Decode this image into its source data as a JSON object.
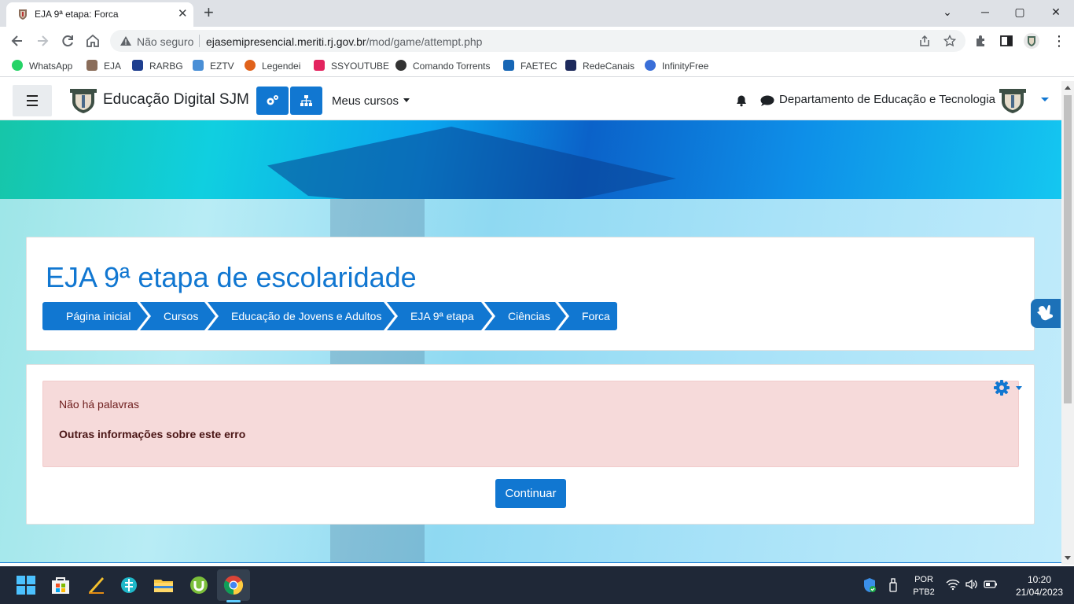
{
  "browser": {
    "tab_title": "EJA 9ª etapa: Forca",
    "tab_close_glyph": "✕",
    "new_tab_glyph": "+",
    "security_label": "Não seguro",
    "url_domain": "ejasemipresencial.meriti.rj.gov.br",
    "url_path": "/mod/game/attempt.php",
    "window_controls": {
      "minimize": "─",
      "maximize": "▢",
      "close": "✕",
      "tabsearch": "⌄"
    },
    "bookmarks": [
      {
        "label": "WhatsApp",
        "icon": "whatsapp-icon",
        "color": "#25d366"
      },
      {
        "label": "EJA",
        "icon": "eja-crest-icon",
        "color": "#8a6d5a"
      },
      {
        "label": "RARBG",
        "icon": "rarbg-icon",
        "color": "#1f3f8f"
      },
      {
        "label": "EZTV",
        "icon": "eztv-icon",
        "color": "#4a8fd6"
      },
      {
        "label": "Legendei",
        "icon": "legendei-icon",
        "color": "#e0621b"
      },
      {
        "label": "SSYOUTUBE",
        "icon": "ssyoutube-icon",
        "color": "#e3245f"
      },
      {
        "label": "Comando Torrents",
        "icon": "comando-torrents-icon",
        "color": "#333333"
      },
      {
        "label": "FAETEC",
        "icon": "faetec-icon",
        "color": "#1766b5"
      },
      {
        "label": "RedeCanais",
        "icon": "redecanais-icon",
        "color": "#1d2a5c"
      },
      {
        "label": "InfinityFree",
        "icon": "infinityfree-icon",
        "color": "#3a6fd8"
      }
    ]
  },
  "site": {
    "name": "Educação Digital SJM",
    "my_courses": "Meus cursos",
    "user_name": "Departamento de Educação e Tecnologia"
  },
  "course": {
    "title": "EJA 9ª etapa de escolaridade",
    "breadcrumb": [
      "Página inicial",
      "Cursos",
      "Educação de Jovens e Adultos",
      "EJA 9ª etapa",
      "Ciências",
      "Forca"
    ]
  },
  "error": {
    "message": "Não há palavras",
    "more_info": "Outras informações sobre este erro"
  },
  "actions": {
    "continue": "Continuar"
  },
  "taskbar": {
    "language": "POR",
    "layout": "PTB2",
    "time": "10:20",
    "date": "21/04/2023"
  },
  "colors": {
    "accent": "#1177d1",
    "error_bg": "#f6dada",
    "taskbar": "#1f2837"
  }
}
